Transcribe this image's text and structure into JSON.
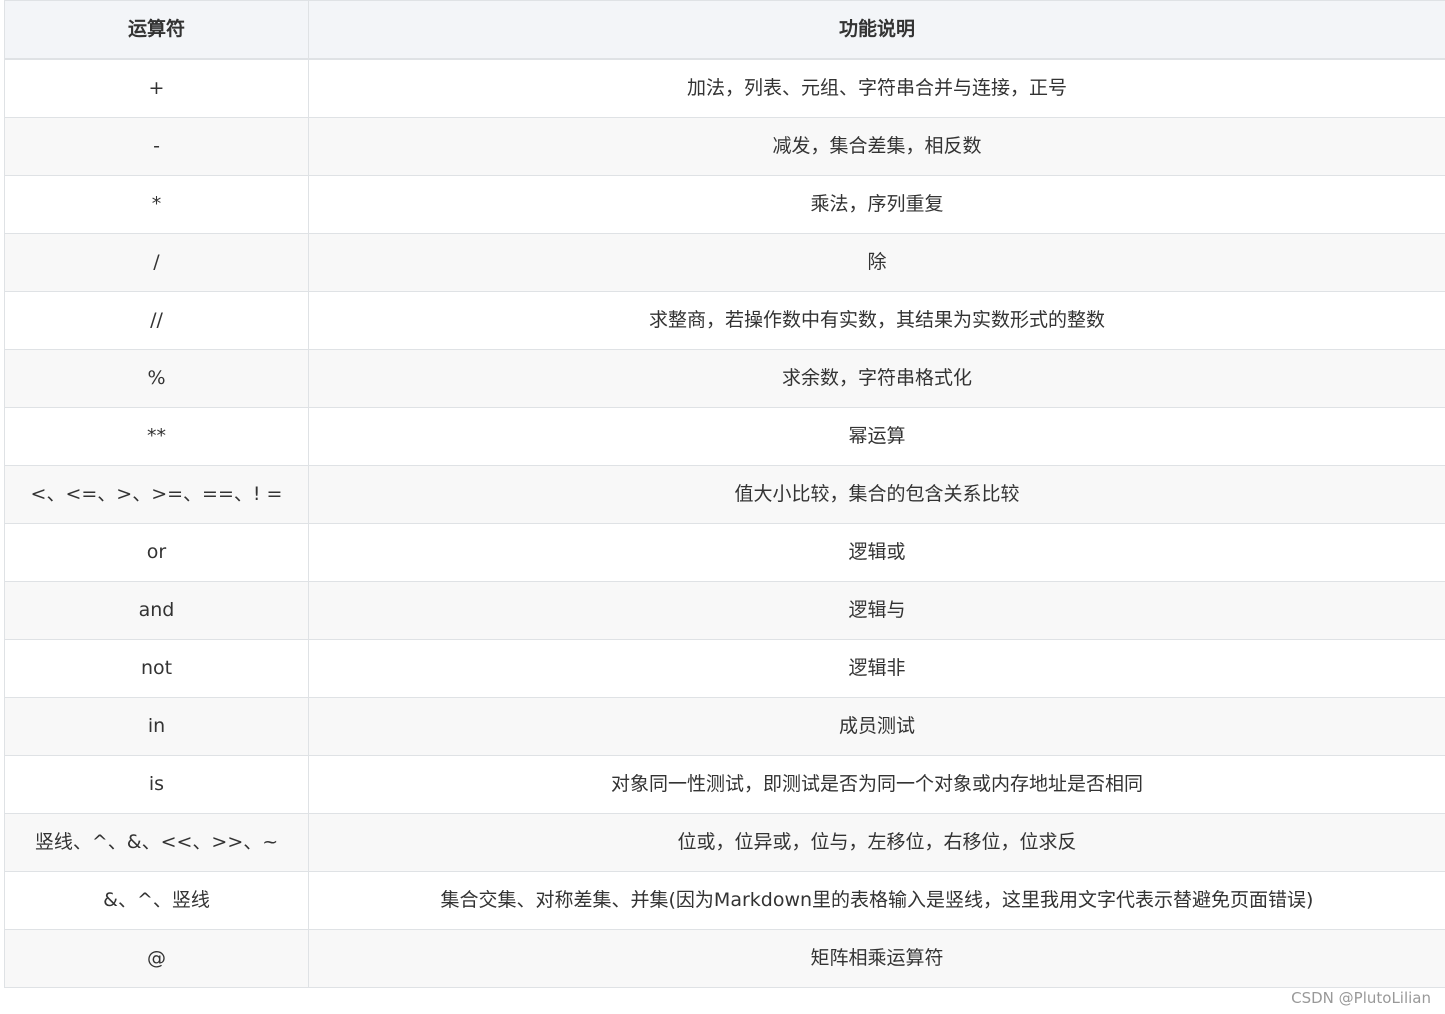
{
  "table": {
    "headers": [
      "运算符",
      "功能说明"
    ],
    "rows": [
      [
        "+",
        "加法，列表、元组、字符串合并与连接，正号"
      ],
      [
        "-",
        "减发，集合差集，相反数"
      ],
      [
        "*",
        "乘法，序列重复"
      ],
      [
        "/",
        "除"
      ],
      [
        "//",
        "求整商，若操作数中有实数，其结果为实数形式的整数"
      ],
      [
        "%",
        "求余数，字符串格式化"
      ],
      [
        "**",
        "幂运算"
      ],
      [
        "<、<=、>、>=、==、! =",
        "值大小比较，集合的包含关系比较"
      ],
      [
        "or",
        "逻辑或"
      ],
      [
        "and",
        "逻辑与"
      ],
      [
        "not",
        "逻辑非"
      ],
      [
        "in",
        "成员测试"
      ],
      [
        "is",
        "对象同一性测试，即测试是否为同一个对象或内存地址是否相同"
      ],
      [
        "竖线、^、&、<<、>>、~",
        "位或，位异或，位与，左移位，右移位，位求反"
      ],
      [
        "&、^、竖线",
        "集合交集、对称差集、并集(因为Markdown里的表格输入是竖线，这里我用文字代表示替避免页面错误)"
      ],
      [
        "@",
        "矩阵相乘运算符"
      ]
    ]
  },
  "watermark": "CSDN @PlutoLilian"
}
